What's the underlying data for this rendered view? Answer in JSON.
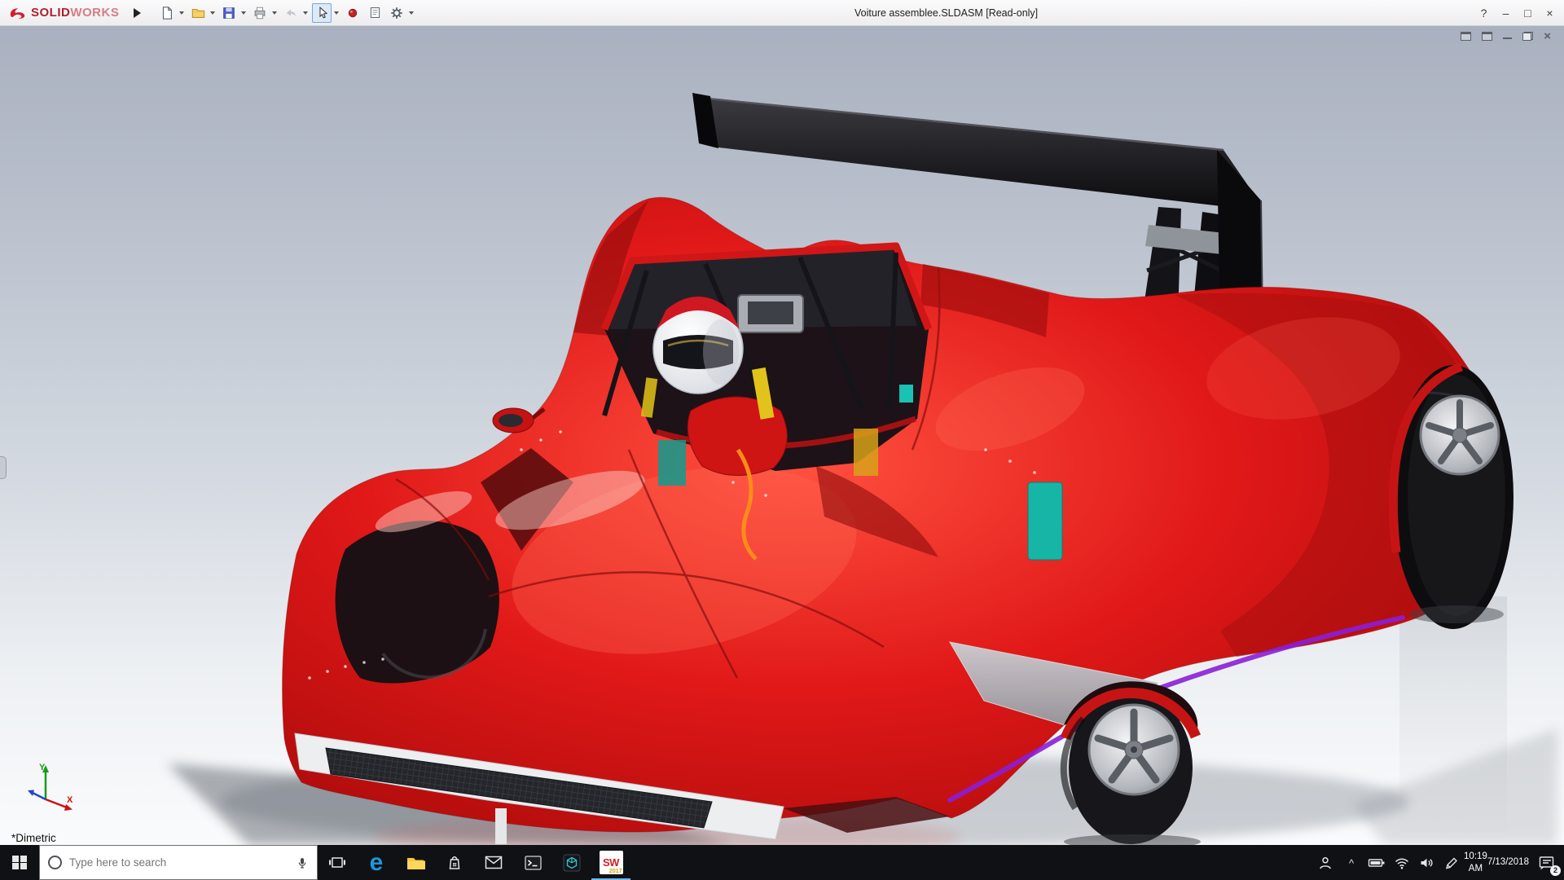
{
  "titlebar": {
    "brand": {
      "solid": "SOLID",
      "works": "WORKS"
    },
    "document_title": "Voiture assemblee.SLDASM [Read-only]",
    "window_controls": {
      "help": "?",
      "minimize": "–",
      "maximize": "□",
      "close": "×"
    },
    "tool_icons": [
      "new-document",
      "open",
      "save",
      "print",
      "undo",
      "select-arrow",
      "appearance-sphere",
      "sheet-properties",
      "options-gear"
    ]
  },
  "viewport": {
    "orientation_label": "*Dimetric",
    "triad": {
      "x_label": "X",
      "y_label": "Y"
    },
    "child_window_controls": {
      "close": "×"
    },
    "model": {
      "description": "red prototype race car with black rear wing and helmeted driver",
      "body_color": "#d21414",
      "wing_color": "#0a0a0c",
      "rim_color": "#c6c9ce",
      "accent_teal": "#17b5a6",
      "accent_purple": "#8b1fd6"
    }
  },
  "taskbar": {
    "search_placeholder": "Type here to search",
    "app_icons": [
      "start",
      "task-view",
      "edge",
      "file-explorer",
      "store",
      "mail",
      "console",
      "model-viewer",
      "solidworks-2017"
    ],
    "glyphs": {
      "edge_letter": "e",
      "sw": "SW",
      "sw_year": "2017"
    },
    "tray_icons": [
      "people",
      "chevron-up",
      "battery",
      "wifi",
      "volume",
      "pen",
      "clock",
      "action-center"
    ],
    "tray": {
      "time": "10:19 AM",
      "date": "7/13/2018",
      "badge": "2"
    }
  }
}
